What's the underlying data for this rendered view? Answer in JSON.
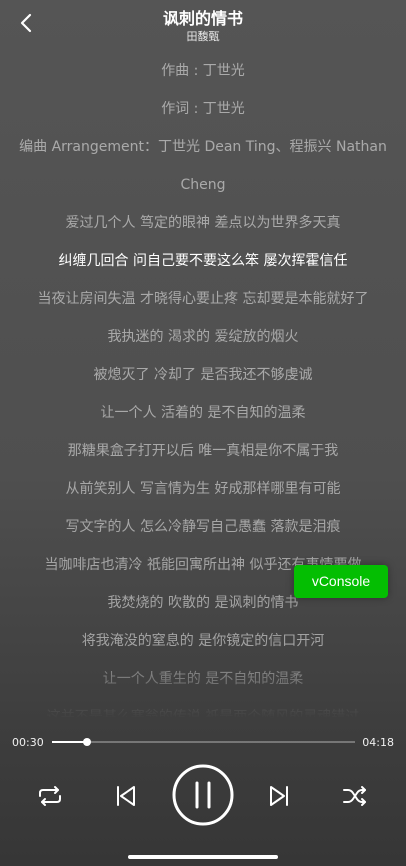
{
  "header": {
    "title": "讽刺的情书",
    "artist": "田馥甄"
  },
  "lyrics": [
    "作曲 : 丁世光",
    "作词 : 丁世光",
    "编曲 Arrangement：丁世光 Dean Ting、程振兴 Nathan",
    "Cheng",
    "爱过几个人 笃定的眼神 差点以为世界多天真",
    "纠缠几回合 问自己要不要这么笨 屡次挥霍信任",
    "当夜让房间失温 才晓得心要止疼 忘却要是本能就好了",
    "我执迷的 渴求的 爱绽放的烟火",
    "被熄灭了 冷却了 是否我还不够虔诚",
    "让一个人 活着的 是不自知的温柔",
    "那糖果盒子打开以后 唯一真相是你不属于我",
    "从前笑别人 写言情为生 好成那样哪里有可能",
    "写文字的人 怎么冷静写自己愚蠢 落款是泪痕",
    "当咖啡店也清冷 祇能回寓所出神 似乎还有事情要做",
    "我焚烧的 吹散的 是讽刺的情书",
    "将我淹没的窒息的 是你镜定的信口开河",
    "让一个人重生的 是不自知的温柔",
    "这并不是甚么寒翁的传说 祇是两个随风的灵魂错过"
  ],
  "active_lyric_index": 5,
  "vconsole_label": "vConsole",
  "player": {
    "current_time": "00:30",
    "duration": "04:18",
    "progress": 0.116
  },
  "icons": {
    "back": "chevron-left-icon",
    "repeat": "repeat-icon",
    "previous": "skip-previous-icon",
    "pause": "pause-icon",
    "next": "skip-next-icon",
    "shuffle": "shuffle-icon"
  },
  "colors": {
    "background": "#555555",
    "active_lyric": "#ffffff",
    "inactive_lyric": "rgba(255,255,255,0.5)",
    "vconsole": "#04be02"
  }
}
